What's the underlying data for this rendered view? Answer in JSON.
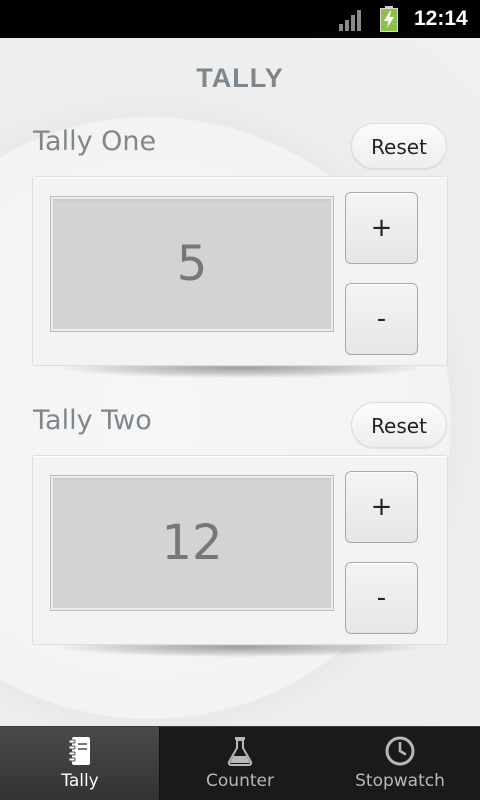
{
  "status_bar": {
    "time": "12:14",
    "signal_icon": "signal-bars-icon",
    "battery_icon": "battery-charging-icon"
  },
  "app": {
    "title": "TALLY"
  },
  "tallies": [
    {
      "label": "Tally One",
      "reset_label": "Reset",
      "value": "5",
      "plus_label": "+",
      "minus_label": "-"
    },
    {
      "label": "Tally Two",
      "reset_label": "Reset",
      "value": "12",
      "plus_label": "+",
      "minus_label": "-"
    }
  ],
  "bottom_nav": {
    "items": [
      {
        "label": "Tally",
        "icon": "notebook-icon",
        "active": true
      },
      {
        "label": "Counter",
        "icon": "flask-icon",
        "active": false
      },
      {
        "label": "Stopwatch",
        "icon": "clock-icon",
        "active": false
      }
    ]
  },
  "colors": {
    "title": "#7d868c",
    "battery_green": "#8bc34a",
    "nav_background": "#1a1a1a"
  }
}
